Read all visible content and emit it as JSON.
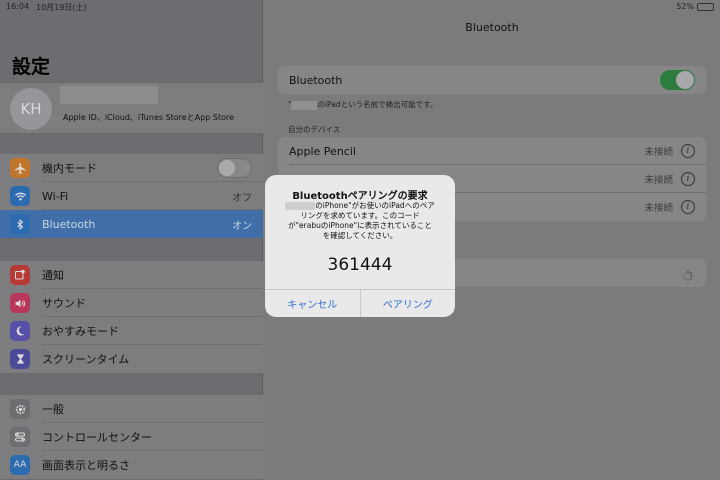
{
  "status_bar": {
    "time": "16:04",
    "date": "10月19日(土)",
    "battery": "52%",
    "battery_level": 0.52
  },
  "sidebar": {
    "title": "設定",
    "profile": {
      "initials": "KH",
      "subtitle": "Apple ID、iCloud、iTunes StoreとApp Store"
    },
    "groups": [
      {
        "items": [
          {
            "label": "機内モード",
            "icon": "airplane-icon",
            "color": "#c0742c",
            "toggle": false
          },
          {
            "label": "Wi-Fi",
            "icon": "wifi-icon",
            "color": "#2d6bb0",
            "value": "オフ"
          },
          {
            "label": "Bluetooth",
            "icon": "bluetooth-icon",
            "color": "#2d6bb0",
            "value": "オン",
            "selected": true
          }
        ]
      },
      {
        "items": [
          {
            "label": "通知",
            "icon": "notifications-icon",
            "color": "#b83a36"
          },
          {
            "label": "サウンド",
            "icon": "sound-icon",
            "color": "#b8365a"
          },
          {
            "label": "おやすみモード",
            "icon": "moon-icon",
            "color": "#5650a8"
          },
          {
            "label": "スクリーンタイム",
            "icon": "hourglass-icon",
            "color": "#4d4a9a"
          }
        ]
      },
      {
        "items": [
          {
            "label": "一般",
            "icon": "gear-icon",
            "color": "#6e6e72"
          },
          {
            "label": "コントロールセンター",
            "icon": "control-center-icon",
            "color": "#6e6e72"
          },
          {
            "label": "画面表示と明るさ",
            "icon": "display-icon",
            "color": "#2d6bb0",
            "icon_text": "AA"
          }
        ]
      }
    ]
  },
  "detail": {
    "title": "Bluetooth",
    "bluetooth_label": "Bluetooth",
    "bluetooth_on": true,
    "discoverable_text": "のiPadという名前で検出可能です。",
    "my_devices_header": "自分のデバイス",
    "devices": [
      {
        "name": "Apple Pencil",
        "status": "未接続"
      },
      {
        "name": "",
        "status": "未接続"
      },
      {
        "name": "",
        "status": "未接続"
      }
    ]
  },
  "alert": {
    "title": "Bluetoothペアリングの要求",
    "message_line1": "のiPhone\"がお使いのiPadへのペア",
    "message_line2": "リングを求めています。このコード",
    "message_line3": "が\"erabuのiPhone\"に表示されていること",
    "message_line4": "を確認してください。",
    "code": "361444",
    "cancel_label": "キャンセル",
    "pair_label": "ペアリング"
  }
}
